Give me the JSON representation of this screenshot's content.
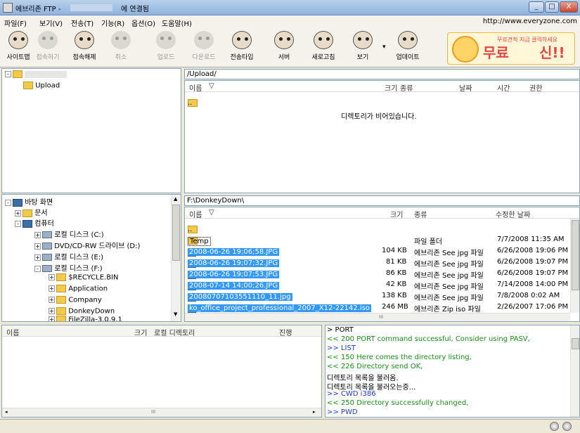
{
  "window": {
    "title": "에브리존 FTP -",
    "status_suffix": "에 연결됨",
    "min": "_",
    "max": "□",
    "close": "X"
  },
  "menu": {
    "items": [
      "파일(F)",
      "보기(V)",
      "전송(T)",
      "기능(R)",
      "옵션(O)",
      "도움말(H)"
    ],
    "url": "http://www.everyzone.com"
  },
  "toolbar": {
    "buttons": [
      {
        "label": "사이트맵",
        "enabled": true
      },
      {
        "label": "접속하기",
        "enabled": false
      },
      {
        "label": "접속해제",
        "enabled": true
      },
      {
        "label": "취소",
        "enabled": false
      },
      {
        "label": "업로드",
        "enabled": false
      },
      {
        "label": "다운로드",
        "enabled": false
      },
      {
        "label": "전송타입",
        "enabled": true
      },
      {
        "label": "서버",
        "enabled": true
      },
      {
        "label": "새로고침",
        "enabled": true
      },
      {
        "label": "보기",
        "enabled": true
      },
      {
        "label": "업데이트",
        "enabled": true
      }
    ],
    "dropdown_arrow": "▾"
  },
  "ad": {
    "big": "무료",
    "small": "무료견적 지금 클릭하세요",
    "tail": "신!!"
  },
  "remote": {
    "tree": {
      "root": "",
      "child": "Upload"
    },
    "path": "/Upload/",
    "columns": {
      "name": "이름",
      "sort": "▽",
      "size": "크기",
      "type": "종류",
      "date": "날짜",
      "time": "시간",
      "perm": "권한"
    },
    "parent": "..",
    "empty_msg": "디렉토리가 비어있습니다."
  },
  "local": {
    "tree": [
      {
        "label": "바탕 화면",
        "indent": 0,
        "icon": "desk"
      },
      {
        "label": "문서",
        "indent": 1,
        "icon": "fold"
      },
      {
        "label": "컴퓨터",
        "indent": 1,
        "icon": "desk"
      },
      {
        "label": "로컬 디스크 (C:)",
        "indent": 2,
        "icon": "drv"
      },
      {
        "label": "DVD/CD-RW 드라이브 (D:)",
        "indent": 2,
        "icon": "drv"
      },
      {
        "label": "로컬 디스크 (E:)",
        "indent": 2,
        "icon": "drv"
      },
      {
        "label": "로컬 디스크 (F:)",
        "indent": 2,
        "icon": "drv"
      },
      {
        "label": "$RECYCLE.BIN",
        "indent": 3,
        "icon": "fold"
      },
      {
        "label": "Application",
        "indent": 3,
        "icon": "fold"
      },
      {
        "label": "Company",
        "indent": 3,
        "icon": "fold"
      },
      {
        "label": "DonkeyDown",
        "indent": 3,
        "icon": "fold"
      },
      {
        "label": "FileZilla-3.0.9.1",
        "indent": 3,
        "icon": "fold"
      }
    ],
    "path": "F:\\DonkeyDown\\",
    "columns": {
      "name": "이름",
      "sort": "▽",
      "size": "크기",
      "type": "종류",
      "modified": "수정한 날짜"
    },
    "files": [
      {
        "name": "..",
        "size": "",
        "type": "",
        "date": "",
        "icon": "fold",
        "selected": false
      },
      {
        "name": "Temp",
        "size": "",
        "type": "파일 폴더",
        "date": "7/7/2008 11:35 AM",
        "icon": "fold",
        "selected": false
      },
      {
        "name": "2008-06-26 19;06;58.JPG",
        "size": "104 KB",
        "type": "에브리존 See jpg 파일",
        "date": "6/26/2008 19:06 PM",
        "icon": "jpg",
        "selected": true
      },
      {
        "name": "2008-06-26 19;07;32.JPG",
        "size": "81 KB",
        "type": "에브리존 See jpg 파일",
        "date": "6/26/2008 19:07 PM",
        "icon": "jpg",
        "selected": true
      },
      {
        "name": "2008-06-26 19;07;53.JPG",
        "size": "86 KB",
        "type": "에브리존 See jpg 파일",
        "date": "6/26/2008 19:07 PM",
        "icon": "jpg",
        "selected": true
      },
      {
        "name": "2008-07-14 14;00;26.JPG",
        "size": "42 KB",
        "type": "에브리존 See jpg 파일",
        "date": "7/14/2008 14:00 PM",
        "icon": "jpg",
        "selected": true
      },
      {
        "name": "20080707103551110_11.jpg",
        "size": "138 KB",
        "type": "에브리존 See jpg 파일",
        "date": "7/8/2008 0:02 AM",
        "icon": "jpg",
        "selected": true
      },
      {
        "name": "ko_office_project_professional_2007_X12-22142.iso",
        "size": "246 MB",
        "type": "에브리존 Zip iso 파일",
        "date": "2/26/2007 17:06 PM",
        "icon": "jpg",
        "selected": true
      }
    ]
  },
  "queue": {
    "columns": {
      "name": "이름",
      "size": "크기",
      "local": "로컬 디렉토리",
      "progress": "진행"
    }
  },
  "log": [
    {
      "text": "> PORT",
      "cls": ""
    },
    {
      "text": "<< 200 PORT command successful, Consider using PASV,",
      "cls": "green"
    },
    {
      "text": ">> LIST",
      "cls": "blue"
    },
    {
      "text": "<< 150 Here comes the directory listing,",
      "cls": "green"
    },
    {
      "text": "<< 226 Directory send OK,",
      "cls": "green"
    },
    {
      "text": "디렉토리 목록을 불러옴.",
      "cls": ""
    },
    {
      "text": "디렉토리 목록을 불러오는중...",
      "cls": ""
    },
    {
      "text": ">> CWD i386",
      "cls": "blue"
    },
    {
      "text": "<< 250 Directory successfully changed,",
      "cls": "green"
    },
    {
      "text": ">> PWD",
      "cls": "blue"
    }
  ],
  "scroll": {
    "mid": "III",
    "up": "▲",
    "down": "▼",
    "left": "◂",
    "right": "▸"
  }
}
